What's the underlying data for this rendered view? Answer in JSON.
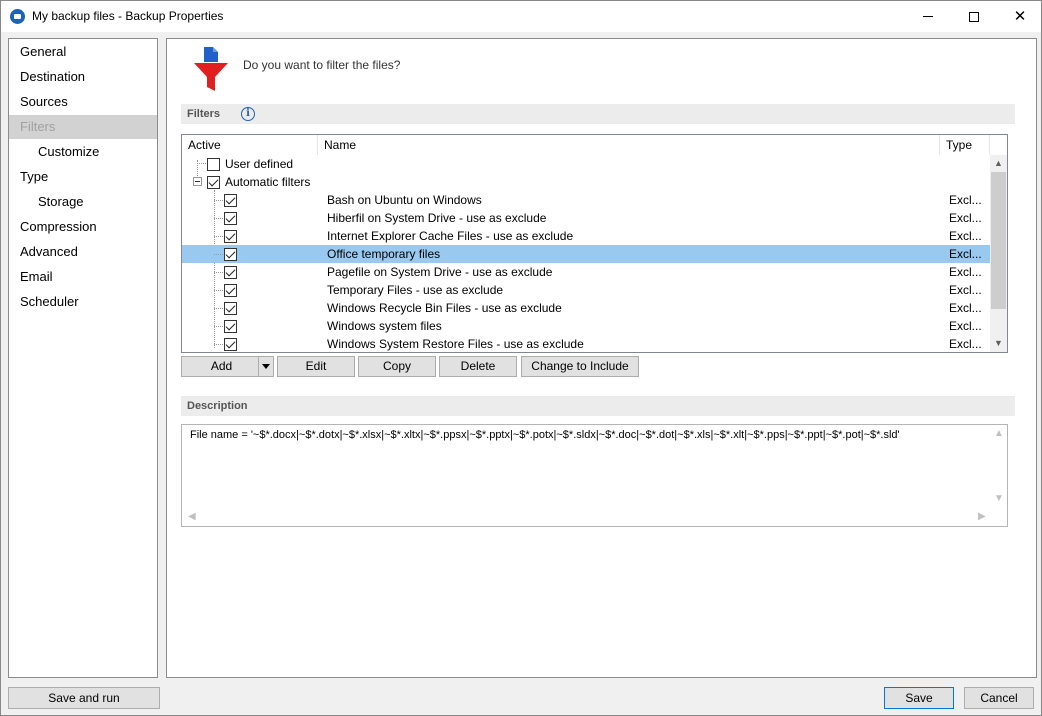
{
  "window": {
    "title": "My backup files - Backup Properties",
    "controls": {
      "minimize": "minimize",
      "maximize": "maximize",
      "close": "✕"
    }
  },
  "nav": {
    "items": [
      {
        "label": "General",
        "sub": false,
        "active": false
      },
      {
        "label": "Destination",
        "sub": false,
        "active": false
      },
      {
        "label": "Sources",
        "sub": false,
        "active": false
      },
      {
        "label": "Filters",
        "sub": false,
        "active": true
      },
      {
        "label": "Customize",
        "sub": true,
        "active": false
      },
      {
        "label": "Type",
        "sub": false,
        "active": false
      },
      {
        "label": "Storage",
        "sub": true,
        "active": false
      },
      {
        "label": "Compression",
        "sub": false,
        "active": false
      },
      {
        "label": "Advanced",
        "sub": false,
        "active": false
      },
      {
        "label": "Email",
        "sub": false,
        "active": false
      },
      {
        "label": "Scheduler",
        "sub": false,
        "active": false
      }
    ]
  },
  "header": {
    "question": "Do you want to filter the files?",
    "icon": "filter-funnel-icon"
  },
  "filters": {
    "section_title": "Filters",
    "info_icon": "i",
    "columns": {
      "active": "Active",
      "name": "Name",
      "type": "Type"
    },
    "groups": [
      {
        "label": "User defined",
        "checked": false
      },
      {
        "label": "Automatic filters",
        "checked": true
      }
    ],
    "rows": [
      {
        "name": "Bash on Ubuntu on Windows",
        "type": "Excl...",
        "checked": true,
        "selected": false
      },
      {
        "name": "Hiberfil on System Drive - use as exclude",
        "type": "Excl...",
        "checked": true,
        "selected": false
      },
      {
        "name": "Internet Explorer Cache Files - use as exclude",
        "type": "Excl...",
        "checked": true,
        "selected": false
      },
      {
        "name": "Office temporary files",
        "type": "Excl...",
        "checked": true,
        "selected": true
      },
      {
        "name": "Pagefile on System Drive - use as exclude",
        "type": "Excl...",
        "checked": true,
        "selected": false
      },
      {
        "name": "Temporary Files - use as exclude",
        "type": "Excl...",
        "checked": true,
        "selected": false
      },
      {
        "name": "Windows Recycle Bin Files - use as exclude",
        "type": "Excl...",
        "checked": true,
        "selected": false
      },
      {
        "name": "Windows system files",
        "type": "Excl...",
        "checked": true,
        "selected": false
      },
      {
        "name": "Windows System Restore Files - use as exclude",
        "type": "Excl...",
        "checked": true,
        "selected": false
      }
    ],
    "buttons": {
      "add": "Add",
      "edit": "Edit",
      "copy": "Copy",
      "delete": "Delete",
      "change": "Change to Include"
    }
  },
  "description": {
    "section_title": "Description",
    "text": "File name = '~$*.docx|~$*.dotx|~$*.xlsx|~$*.xltx|~$*.ppsx|~$*.pptx|~$*.potx|~$*.sldx|~$*.doc|~$*.dot|~$*.xls|~$*.xlt|~$*.pps|~$*.ppt|~$*.pot|~$*.sld'"
  },
  "footer": {
    "save_and_run": "Save and run",
    "save": "Save",
    "cancel": "Cancel"
  },
  "colors": {
    "selected_row": "#99c9ef",
    "active_nav_bg": "#d2d2d2",
    "accent_blue": "#1f5fb3",
    "funnel_red": "#e02020"
  }
}
